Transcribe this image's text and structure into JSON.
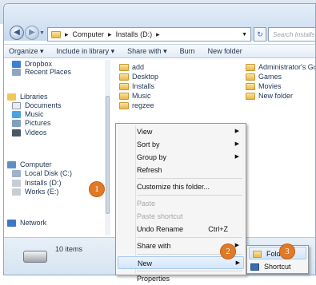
{
  "address": {
    "crumbs": [
      "Computer",
      "Installs (D:)"
    ],
    "search_placeholder": "Search Installs (D:)"
  },
  "toolbar": {
    "organize": "Organize ▾",
    "include": "Include in library ▾",
    "share": "Share with ▾",
    "burn": "Burn",
    "newfolder": "New folder"
  },
  "nav": {
    "dropbox": "Dropbox",
    "recent": "Recent Places",
    "libraries": "Libraries",
    "documents": "Documents",
    "music": "Music",
    "pictures": "Pictures",
    "videos": "Videos",
    "computer": "Computer",
    "local": "Local Disk (C:)",
    "installs": "Installs (D:)",
    "works": "Works (E:)",
    "network": "Network"
  },
  "files": {
    "col1": [
      "add",
      "Desktop",
      "Installs",
      "Music",
      "regzee"
    ],
    "col2": [
      "Administrator's Guide",
      "Games",
      "Movies",
      "New folder"
    ]
  },
  "status": {
    "count": "10 items"
  },
  "context_menu": {
    "view": "View",
    "sortby": "Sort by",
    "groupby": "Group by",
    "refresh": "Refresh",
    "customize": "Customize this folder...",
    "paste": "Paste",
    "paste_shortcut": "Paste shortcut",
    "undo": "Undo Rename",
    "undo_key": "Ctrl+Z",
    "share": "Share with",
    "new": "New",
    "properties": "Properties"
  },
  "submenu": {
    "folder": "Folder",
    "shortcut": "Shortcut"
  },
  "badges": {
    "b1": "1",
    "b2": "2",
    "b3": "3",
    "color": "#e07a27"
  }
}
